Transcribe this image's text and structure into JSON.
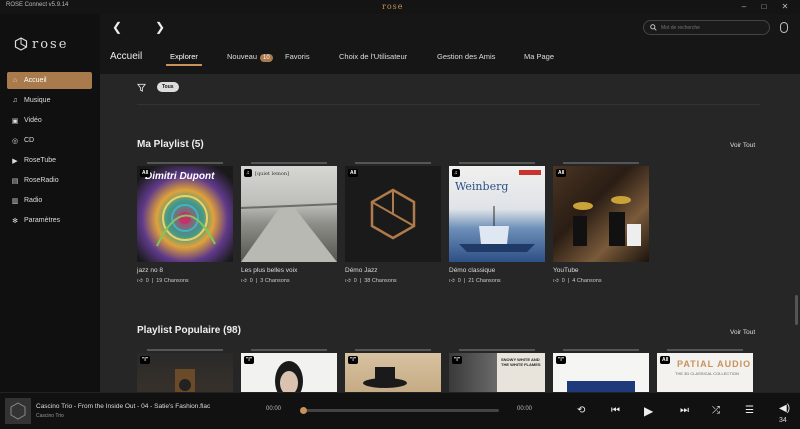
{
  "app": {
    "title": "ROSE Connect v5.9.14",
    "logo_text": "rose"
  },
  "titlebar": {
    "minimize": "–",
    "maximize": "□",
    "close": "✕"
  },
  "brand": "rose",
  "sidebar": {
    "items": [
      {
        "label": "Accueil",
        "icon": "home-icon",
        "active": true
      },
      {
        "label": "Musique",
        "icon": "music-icon"
      },
      {
        "label": "Vidéo",
        "icon": "video-icon"
      },
      {
        "label": "CD",
        "icon": "cd-icon"
      },
      {
        "label": "RoseTube",
        "icon": "rosetube-icon"
      },
      {
        "label": "RoseRadio",
        "icon": "roseradio-icon"
      },
      {
        "label": "Radio",
        "icon": "radio-icon"
      },
      {
        "label": "Paramètres",
        "icon": "gear-icon"
      }
    ]
  },
  "search": {
    "placeholder": "Mot de recherche"
  },
  "header": {
    "title": "Accueil",
    "tabs": [
      {
        "label": "Explorer",
        "active": true
      },
      {
        "label": "Nouveau",
        "badge": "10"
      },
      {
        "label": "Favoris"
      },
      {
        "label": "Choix de l'Utilisateur"
      },
      {
        "label": "Gestion des Amis"
      },
      {
        "label": "Ma Page"
      }
    ]
  },
  "filter": {
    "chip": "Tous"
  },
  "sections": {
    "my_playlist": {
      "title": "Ma Playlist (5)",
      "see_all": "Voir Tout",
      "cards": [
        {
          "tag": "All",
          "cover_text": "Dimitri Dupont",
          "name": "jazz no 8",
          "likes": "0",
          "count": "19 Chansons"
        },
        {
          "tag": "♫",
          "cover_text": "[quiet lemon]",
          "name": "Les plus belles voix",
          "likes": "0",
          "count": "3 Chansons"
        },
        {
          "tag": "All",
          "cover_text": "",
          "name": "Démo Jazz",
          "likes": "0",
          "count": "38 Chansons"
        },
        {
          "tag": "♫",
          "cover_text": "Weinberg",
          "name": "Démo classique",
          "likes": "0",
          "count": "21 Chansons"
        },
        {
          "tag": "All",
          "cover_text": "",
          "name": "YouTube",
          "likes": "0",
          "count": "4 Chansons"
        }
      ]
    },
    "popular": {
      "title": "Playlist Populaire (98)",
      "see_all": "Voir Tout",
      "cards": [
        {
          "tag": "\"I\""
        },
        {
          "tag": "\"I\""
        },
        {
          "tag": "\"I\""
        },
        {
          "tag": "\"I\"",
          "cover_text": "SNOWY WHITE AND THE WHITE FLAMES"
        },
        {
          "tag": "\"I\""
        },
        {
          "tag": "All",
          "cover_text": "PATIAL AUDIO",
          "sub_text": "THE 3D CLASSICAL COLLECTION"
        }
      ]
    }
  },
  "player": {
    "title": "Cascino Trio - From the Inside Out - 04 - Satie's Fashion.flac",
    "artist": "Cascino Trio",
    "time_current": "00:00",
    "time_total": "00:00",
    "progress": 0,
    "volume": "34"
  },
  "colors": {
    "accent": "#a87a4c",
    "background": "#262626",
    "sidebar": "#101010"
  }
}
